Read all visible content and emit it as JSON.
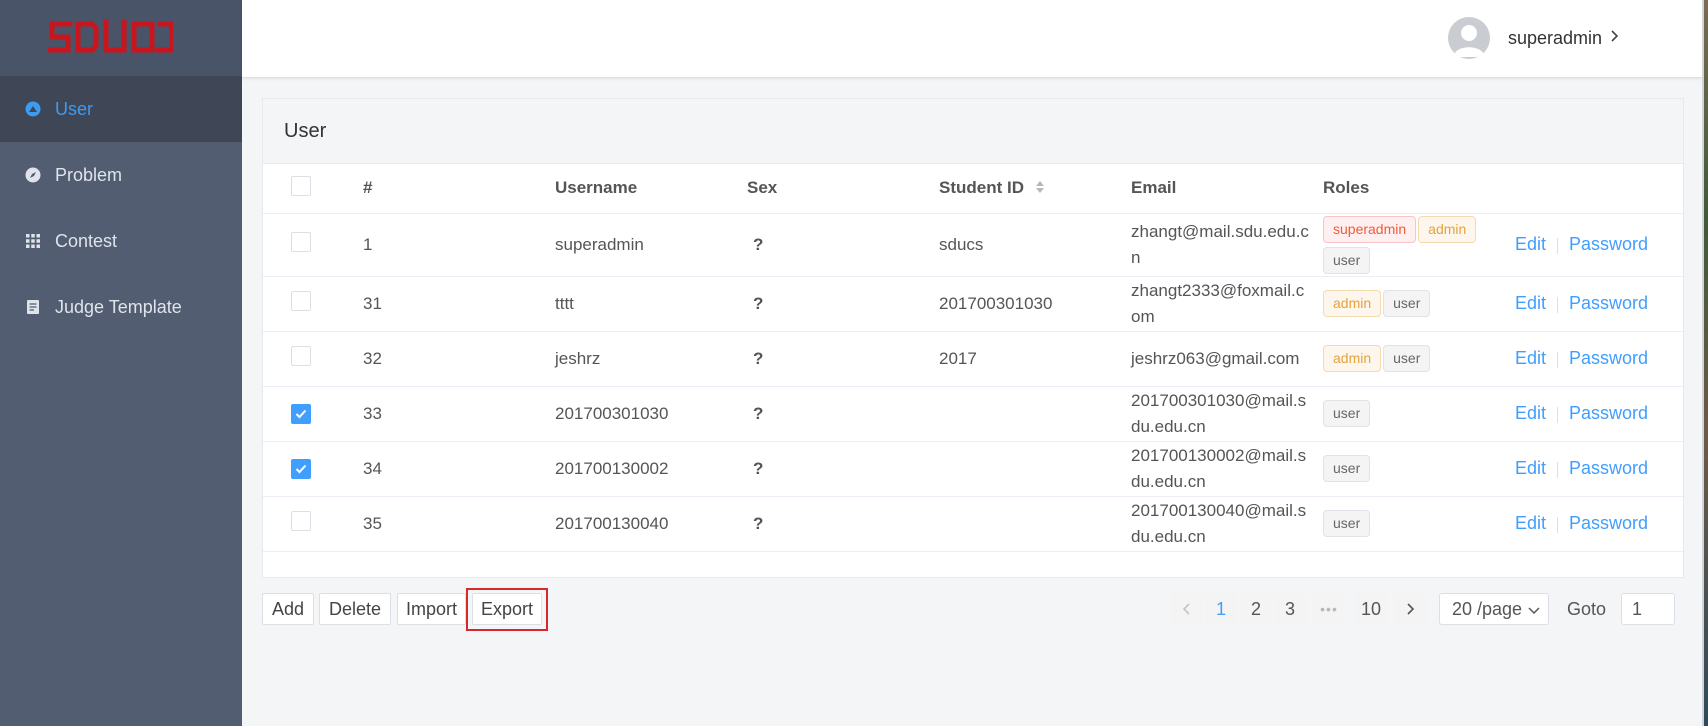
{
  "app": {
    "logo_text": "SDUOJ"
  },
  "sidebar": {
    "items": [
      {
        "label": "User",
        "icon": "user-circle-icon",
        "active": true
      },
      {
        "label": "Problem",
        "icon": "compass-icon",
        "active": false
      },
      {
        "label": "Contest",
        "icon": "grid-icon",
        "active": false
      },
      {
        "label": "Judge Template",
        "icon": "document-icon",
        "active": false
      }
    ]
  },
  "header": {
    "username": "superadmin"
  },
  "card": {
    "title": "User",
    "columns": {
      "index": "#",
      "username": "Username",
      "sex": "Sex",
      "student_id": "Student ID",
      "email": "Email",
      "roles": "Roles"
    },
    "rows": [
      {
        "checked": false,
        "id": "1",
        "username": "superadmin",
        "sex": "?",
        "student_id": "sducs",
        "email": "zhangt@mail.sdu.edu.cn",
        "roles": [
          "superadmin",
          "admin",
          "user"
        ]
      },
      {
        "checked": false,
        "id": "31",
        "username": "tttt",
        "sex": "?",
        "student_id": "201700301030",
        "email": "zhangt2333@foxmail.com",
        "roles": [
          "admin",
          "user"
        ]
      },
      {
        "checked": false,
        "id": "32",
        "username": "jeshrz",
        "sex": "?",
        "student_id": "2017",
        "email": "jeshrz063@gmail.com",
        "roles": [
          "admin",
          "user"
        ]
      },
      {
        "checked": true,
        "id": "33",
        "username": "201700301030",
        "sex": "?",
        "student_id": "",
        "email": "201700301030@mail.sdu.edu.cn",
        "roles": [
          "user"
        ]
      },
      {
        "checked": true,
        "id": "34",
        "username": "201700130002",
        "sex": "?",
        "student_id": "",
        "email": "201700130002@mail.sdu.edu.cn",
        "roles": [
          "user"
        ]
      },
      {
        "checked": false,
        "id": "35",
        "username": "201700130040",
        "sex": "?",
        "student_id": "",
        "email": "201700130040@mail.sdu.edu.cn",
        "roles": [
          "user"
        ]
      }
    ],
    "row_actions": {
      "edit": "Edit",
      "password": "Password"
    }
  },
  "toolbar": {
    "add": "Add",
    "delete": "Delete",
    "import": "Import",
    "export": "Export"
  },
  "pagination": {
    "pages": [
      "1",
      "2",
      "3"
    ],
    "ellipsis": "•••",
    "last_page": "10",
    "current_page": "1",
    "page_size": "20 /page",
    "goto_label": "Goto",
    "goto_value": "1"
  },
  "colors": {
    "sidebar_bg": "#525d71",
    "active_accent": "#3d9bf0",
    "link": "#409eff",
    "highlight_border": "#d9272e",
    "logo": "#c8151e"
  }
}
